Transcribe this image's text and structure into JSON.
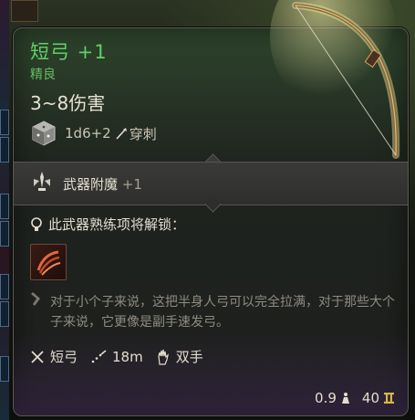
{
  "item": {
    "name": "短弓 +1",
    "rarity": "精良",
    "damage": "3~8伤害",
    "dice_formula": "1d6+2",
    "damage_type": "穿刺",
    "enchantment": {
      "label": "武器附魔",
      "bonus": "+1"
    },
    "unlock_text": "此武器熟练项将解锁：",
    "description": "对于小个子来说，这把半身人弓可以完全拉满，对于那些大个子来说，它更像是副手速发弓。",
    "properties": [
      {
        "icon": "crossed-swords-icon",
        "label": "短弓"
      },
      {
        "icon": "range-icon",
        "label": "18m"
      },
      {
        "icon": "hand-icon",
        "label": "双手"
      }
    ],
    "weight": "0.9",
    "price": "40"
  },
  "colors": {
    "name": "#5ed065",
    "rarity": "#62c060",
    "text": "#e3ddcf",
    "muted": "#8f8b80",
    "gold": "#d8b64a"
  }
}
